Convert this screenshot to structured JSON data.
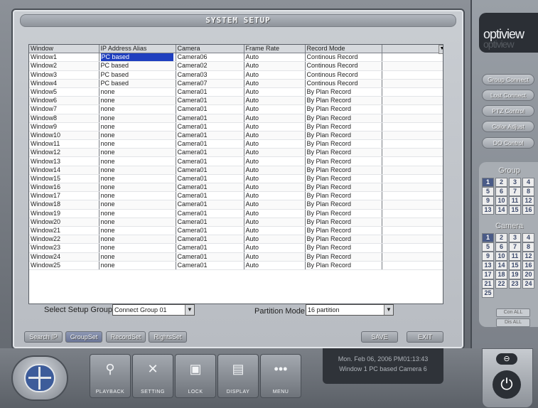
{
  "title": "SYSTEM SETUP",
  "table": {
    "headers": [
      "Window",
      "IP Address Alias",
      "Camera",
      "Frame Rate",
      "Record Mode"
    ],
    "rows": [
      [
        "Window1",
        "PC based",
        "Camera06",
        "Auto",
        "Continous Record"
      ],
      [
        "Window2",
        "PC based",
        "Camera02",
        "Auto",
        "Continous Record"
      ],
      [
        "Window3",
        "PC based",
        "Camera03",
        "Auto",
        "Continous Record"
      ],
      [
        "Window4",
        "PC based",
        "Camera07",
        "Auto",
        "Continous Record"
      ],
      [
        "Window5",
        "none",
        "Camera01",
        "Auto",
        "By Plan Record"
      ],
      [
        "Window6",
        "none",
        "Camera01",
        "Auto",
        "By Plan Record"
      ],
      [
        "Window7",
        "none",
        "Camera01",
        "Auto",
        "By Plan Record"
      ],
      [
        "Window8",
        "none",
        "Camera01",
        "Auto",
        "By Plan Record"
      ],
      [
        "Window9",
        "none",
        "Camera01",
        "Auto",
        "By Plan Record"
      ],
      [
        "Window10",
        "none",
        "Camera01",
        "Auto",
        "By Plan Record"
      ],
      [
        "Window11",
        "none",
        "Camera01",
        "Auto",
        "By Plan Record"
      ],
      [
        "Window12",
        "none",
        "Camera01",
        "Auto",
        "By Plan Record"
      ],
      [
        "Window13",
        "none",
        "Camera01",
        "Auto",
        "By Plan Record"
      ],
      [
        "Window14",
        "none",
        "Camera01",
        "Auto",
        "By Plan Record"
      ],
      [
        "Window15",
        "none",
        "Camera01",
        "Auto",
        "By Plan Record"
      ],
      [
        "Window16",
        "none",
        "Camera01",
        "Auto",
        "By Plan Record"
      ],
      [
        "Window17",
        "none",
        "Camera01",
        "Auto",
        "By Plan Record"
      ],
      [
        "Window18",
        "none",
        "Camera01",
        "Auto",
        "By Plan Record"
      ],
      [
        "Window19",
        "none",
        "Camera01",
        "Auto",
        "By Plan Record"
      ],
      [
        "Window20",
        "none",
        "Camera01",
        "Auto",
        "By Plan Record"
      ],
      [
        "Window21",
        "none",
        "Camera01",
        "Auto",
        "By Plan Record"
      ],
      [
        "Window22",
        "none",
        "Camera01",
        "Auto",
        "By Plan Record"
      ],
      [
        "Window23",
        "none",
        "Camera01",
        "Auto",
        "By Plan Record"
      ],
      [
        "Window24",
        "none",
        "Camera01",
        "Auto",
        "By Plan Record"
      ],
      [
        "Window25",
        "none",
        "Camera01",
        "Auto",
        "By Plan Record"
      ]
    ],
    "selected_dropdown_icon": "chevron-down-icon"
  },
  "setup_group": {
    "label": "Select Setup Group",
    "value": "Connect Group 01"
  },
  "partition": {
    "label": "Partition Mode",
    "value": "16 partition"
  },
  "bottom_buttons": [
    "Search IP",
    "GroupSet",
    "RecordSet",
    "RightsSet"
  ],
  "save_label": "SAVE",
  "exit_label": "EXIT",
  "brand": {
    "logo": "optiview",
    "logo_reflection": "optiview"
  },
  "side_buttons": [
    "Group Connect",
    "Lost Connect",
    "PTZ Control",
    "Color Adjust",
    "DO Control"
  ],
  "group": {
    "title": "Group",
    "numbers": [
      "1",
      "2",
      "3",
      "4",
      "5",
      "6",
      "7",
      "8",
      "9",
      "10",
      "11",
      "12",
      "13",
      "14",
      "15",
      "16"
    ],
    "selected": "1"
  },
  "camera": {
    "title": "Camera",
    "numbers": [
      "1",
      "2",
      "3",
      "4",
      "5",
      "6",
      "7",
      "8",
      "9",
      "10",
      "11",
      "12",
      "13",
      "14",
      "15",
      "16",
      "17",
      "18",
      "19",
      "20",
      "21",
      "22",
      "23",
      "24",
      "25"
    ],
    "selected": "1"
  },
  "con_all": "Con ALL",
  "dis_all": "Dis ALL",
  "dock": [
    {
      "label": "PLAYBACK",
      "icon": "binoculars-icon"
    },
    {
      "label": "SETTING",
      "icon": "tools-icon"
    },
    {
      "label": "LOCK",
      "icon": "lock-icon"
    },
    {
      "label": "DISPLAY",
      "icon": "display-icon"
    },
    {
      "label": "MENU",
      "icon": "menu-icon"
    }
  ],
  "status": {
    "datetime": "Mon. Feb 06, 2006   PM01:13:43",
    "info": "Window 1  PC based Camera 6"
  },
  "colors": {
    "accent": "#4a5b87",
    "selected_row": "#1f3fbf"
  }
}
